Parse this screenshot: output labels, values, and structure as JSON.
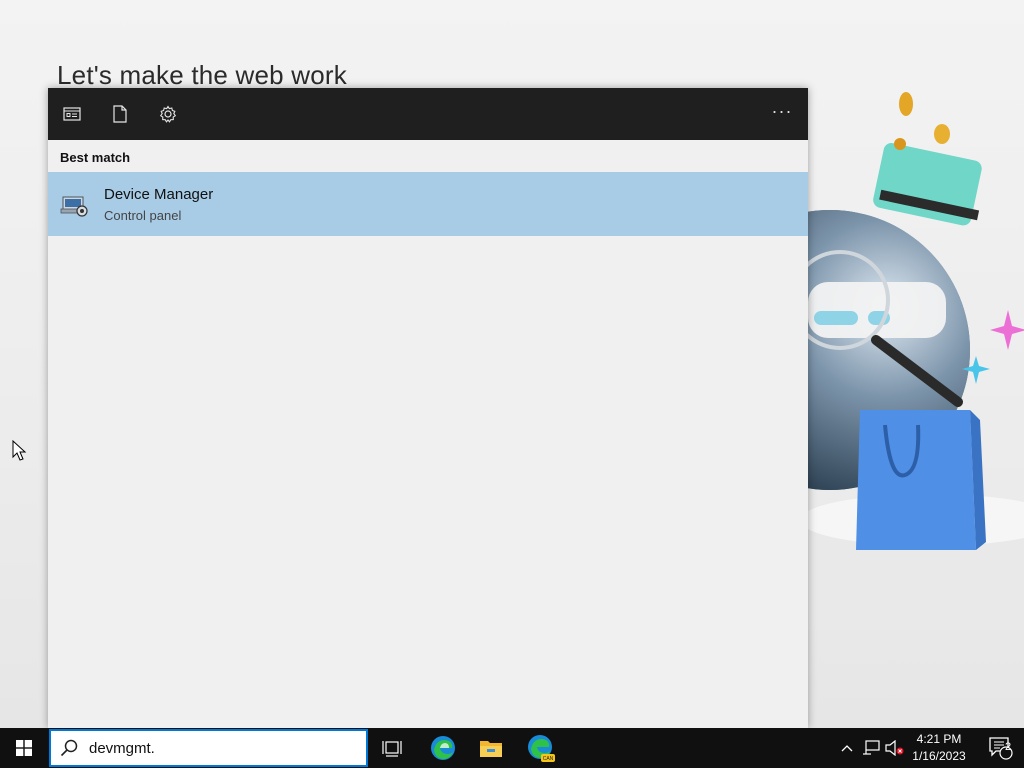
{
  "background": {
    "heading": "Let's make the web work"
  },
  "search_panel": {
    "toolbar": {
      "icons": [
        "apps-icon",
        "documents-icon",
        "settings-icon"
      ],
      "more_label": "···"
    },
    "section_label": "Best match",
    "results": [
      {
        "title": "Device Manager",
        "subtitle": "Control panel",
        "icon": "device-manager-icon"
      }
    ]
  },
  "taskbar": {
    "search": {
      "value": "devmgmt."
    },
    "pinned": [
      "task-view-icon",
      "edge-icon",
      "file-explorer-icon",
      "edge-canary-icon"
    ],
    "clock": {
      "time": "4:21 PM",
      "date": "1/16/2023"
    },
    "notification_count": "2",
    "colors": {
      "taskbar": "#101010",
      "accent": "#0078d7",
      "selection": "#a9cce6"
    }
  }
}
